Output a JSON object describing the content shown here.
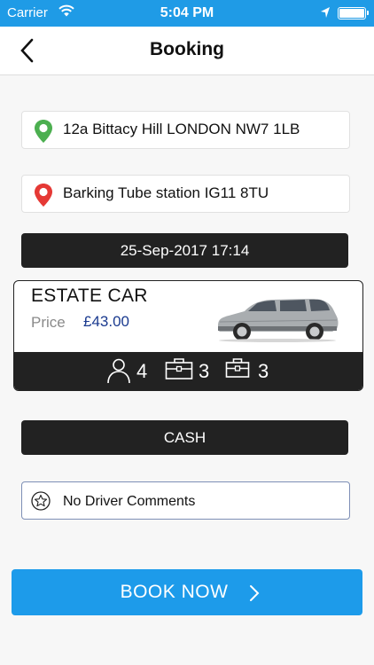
{
  "status_bar": {
    "carrier": "Carrier",
    "time": "5:04 PM",
    "icons": [
      "wifi-icon",
      "location-arrow-icon",
      "battery-icon"
    ]
  },
  "nav": {
    "title": "Booking",
    "back_icon": "chevron-left-icon"
  },
  "pickup": {
    "address": "12a Bittacy Hill LONDON NW7 1LB",
    "icon": "map-pin-green-icon",
    "icon_color": "#4caf50"
  },
  "dropoff": {
    "address": "Barking Tube station IG11 8TU",
    "icon": "map-pin-red-icon",
    "icon_color": "#e53935"
  },
  "datetime": "25-Sep-2017 17:14",
  "vehicle": {
    "name": "ESTATE CAR",
    "price_label": "Price",
    "price": "£43.00",
    "image": "silver-estate-car",
    "passengers": "4",
    "large_luggage": "3",
    "small_luggage": "3"
  },
  "payment_method": "CASH",
  "driver_comments": "No Driver Comments",
  "book_button": "BOOK NOW",
  "colors": {
    "accent": "#1d9bea",
    "dark": "#222222",
    "price": "#1a3a8f"
  }
}
